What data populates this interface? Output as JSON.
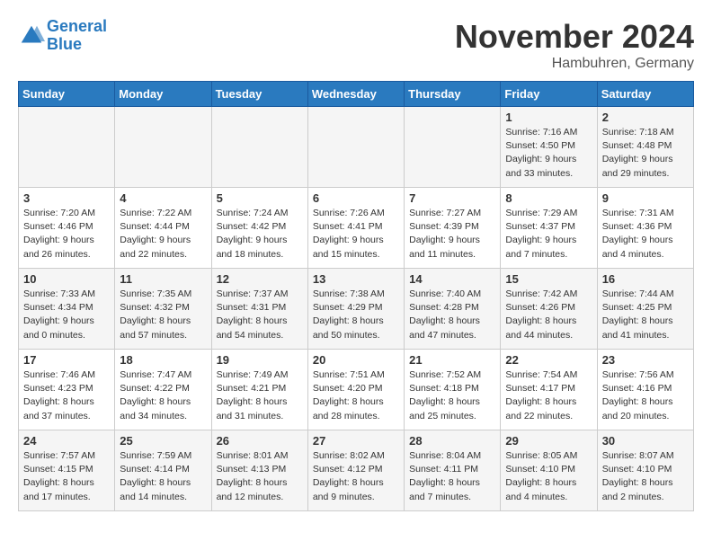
{
  "header": {
    "logo_line1": "General",
    "logo_line2": "Blue",
    "month_title": "November 2024",
    "location": "Hambuhren, Germany"
  },
  "days_of_week": [
    "Sunday",
    "Monday",
    "Tuesday",
    "Wednesday",
    "Thursday",
    "Friday",
    "Saturday"
  ],
  "weeks": [
    [
      {
        "num": "",
        "sunrise": "",
        "sunset": "",
        "daylight": ""
      },
      {
        "num": "",
        "sunrise": "",
        "sunset": "",
        "daylight": ""
      },
      {
        "num": "",
        "sunrise": "",
        "sunset": "",
        "daylight": ""
      },
      {
        "num": "",
        "sunrise": "",
        "sunset": "",
        "daylight": ""
      },
      {
        "num": "",
        "sunrise": "",
        "sunset": "",
        "daylight": ""
      },
      {
        "num": "1",
        "sunrise": "Sunrise: 7:16 AM",
        "sunset": "Sunset: 4:50 PM",
        "daylight": "Daylight: 9 hours and 33 minutes."
      },
      {
        "num": "2",
        "sunrise": "Sunrise: 7:18 AM",
        "sunset": "Sunset: 4:48 PM",
        "daylight": "Daylight: 9 hours and 29 minutes."
      }
    ],
    [
      {
        "num": "3",
        "sunrise": "Sunrise: 7:20 AM",
        "sunset": "Sunset: 4:46 PM",
        "daylight": "Daylight: 9 hours and 26 minutes."
      },
      {
        "num": "4",
        "sunrise": "Sunrise: 7:22 AM",
        "sunset": "Sunset: 4:44 PM",
        "daylight": "Daylight: 9 hours and 22 minutes."
      },
      {
        "num": "5",
        "sunrise": "Sunrise: 7:24 AM",
        "sunset": "Sunset: 4:42 PM",
        "daylight": "Daylight: 9 hours and 18 minutes."
      },
      {
        "num": "6",
        "sunrise": "Sunrise: 7:26 AM",
        "sunset": "Sunset: 4:41 PM",
        "daylight": "Daylight: 9 hours and 15 minutes."
      },
      {
        "num": "7",
        "sunrise": "Sunrise: 7:27 AM",
        "sunset": "Sunset: 4:39 PM",
        "daylight": "Daylight: 9 hours and 11 minutes."
      },
      {
        "num": "8",
        "sunrise": "Sunrise: 7:29 AM",
        "sunset": "Sunset: 4:37 PM",
        "daylight": "Daylight: 9 hours and 7 minutes."
      },
      {
        "num": "9",
        "sunrise": "Sunrise: 7:31 AM",
        "sunset": "Sunset: 4:36 PM",
        "daylight": "Daylight: 9 hours and 4 minutes."
      }
    ],
    [
      {
        "num": "10",
        "sunrise": "Sunrise: 7:33 AM",
        "sunset": "Sunset: 4:34 PM",
        "daylight": "Daylight: 9 hours and 0 minutes."
      },
      {
        "num": "11",
        "sunrise": "Sunrise: 7:35 AM",
        "sunset": "Sunset: 4:32 PM",
        "daylight": "Daylight: 8 hours and 57 minutes."
      },
      {
        "num": "12",
        "sunrise": "Sunrise: 7:37 AM",
        "sunset": "Sunset: 4:31 PM",
        "daylight": "Daylight: 8 hours and 54 minutes."
      },
      {
        "num": "13",
        "sunrise": "Sunrise: 7:38 AM",
        "sunset": "Sunset: 4:29 PM",
        "daylight": "Daylight: 8 hours and 50 minutes."
      },
      {
        "num": "14",
        "sunrise": "Sunrise: 7:40 AM",
        "sunset": "Sunset: 4:28 PM",
        "daylight": "Daylight: 8 hours and 47 minutes."
      },
      {
        "num": "15",
        "sunrise": "Sunrise: 7:42 AM",
        "sunset": "Sunset: 4:26 PM",
        "daylight": "Daylight: 8 hours and 44 minutes."
      },
      {
        "num": "16",
        "sunrise": "Sunrise: 7:44 AM",
        "sunset": "Sunset: 4:25 PM",
        "daylight": "Daylight: 8 hours and 41 minutes."
      }
    ],
    [
      {
        "num": "17",
        "sunrise": "Sunrise: 7:46 AM",
        "sunset": "Sunset: 4:23 PM",
        "daylight": "Daylight: 8 hours and 37 minutes."
      },
      {
        "num": "18",
        "sunrise": "Sunrise: 7:47 AM",
        "sunset": "Sunset: 4:22 PM",
        "daylight": "Daylight: 8 hours and 34 minutes."
      },
      {
        "num": "19",
        "sunrise": "Sunrise: 7:49 AM",
        "sunset": "Sunset: 4:21 PM",
        "daylight": "Daylight: 8 hours and 31 minutes."
      },
      {
        "num": "20",
        "sunrise": "Sunrise: 7:51 AM",
        "sunset": "Sunset: 4:20 PM",
        "daylight": "Daylight: 8 hours and 28 minutes."
      },
      {
        "num": "21",
        "sunrise": "Sunrise: 7:52 AM",
        "sunset": "Sunset: 4:18 PM",
        "daylight": "Daylight: 8 hours and 25 minutes."
      },
      {
        "num": "22",
        "sunrise": "Sunrise: 7:54 AM",
        "sunset": "Sunset: 4:17 PM",
        "daylight": "Daylight: 8 hours and 22 minutes."
      },
      {
        "num": "23",
        "sunrise": "Sunrise: 7:56 AM",
        "sunset": "Sunset: 4:16 PM",
        "daylight": "Daylight: 8 hours and 20 minutes."
      }
    ],
    [
      {
        "num": "24",
        "sunrise": "Sunrise: 7:57 AM",
        "sunset": "Sunset: 4:15 PM",
        "daylight": "Daylight: 8 hours and 17 minutes."
      },
      {
        "num": "25",
        "sunrise": "Sunrise: 7:59 AM",
        "sunset": "Sunset: 4:14 PM",
        "daylight": "Daylight: 8 hours and 14 minutes."
      },
      {
        "num": "26",
        "sunrise": "Sunrise: 8:01 AM",
        "sunset": "Sunset: 4:13 PM",
        "daylight": "Daylight: 8 hours and 12 minutes."
      },
      {
        "num": "27",
        "sunrise": "Sunrise: 8:02 AM",
        "sunset": "Sunset: 4:12 PM",
        "daylight": "Daylight: 8 hours and 9 minutes."
      },
      {
        "num": "28",
        "sunrise": "Sunrise: 8:04 AM",
        "sunset": "Sunset: 4:11 PM",
        "daylight": "Daylight: 8 hours and 7 minutes."
      },
      {
        "num": "29",
        "sunrise": "Sunrise: 8:05 AM",
        "sunset": "Sunset: 4:10 PM",
        "daylight": "Daylight: 8 hours and 4 minutes."
      },
      {
        "num": "30",
        "sunrise": "Sunrise: 8:07 AM",
        "sunset": "Sunset: 4:10 PM",
        "daylight": "Daylight: 8 hours and 2 minutes."
      }
    ]
  ]
}
